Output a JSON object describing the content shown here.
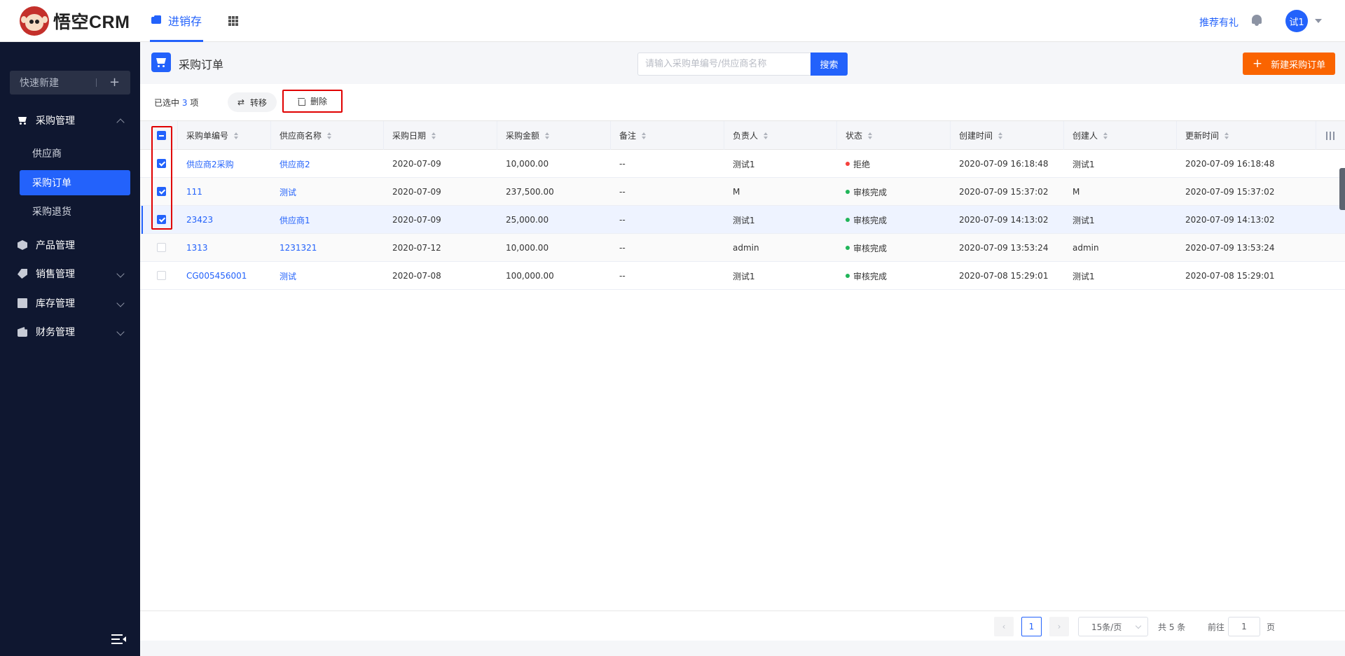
{
  "app": {
    "logo_text": "悟空CRM",
    "top_tab": "进销存",
    "recommend": "推荐有礼",
    "avatar_text": "试1"
  },
  "sidebar": {
    "quick_new": "快速新建",
    "groups": [
      {
        "label": "采购管理",
        "icon": "cart-icon",
        "expanded": true,
        "items": [
          {
            "label": "供应商"
          },
          {
            "label": "采购订单",
            "active": true
          },
          {
            "label": "采购退货"
          }
        ]
      },
      {
        "label": "产品管理",
        "icon": "box-icon"
      },
      {
        "label": "销售管理",
        "icon": "tag-icon"
      },
      {
        "label": "库存管理",
        "icon": "store-icon"
      },
      {
        "label": "财务管理",
        "icon": "wallet-icon"
      }
    ]
  },
  "header": {
    "title": "采购订单",
    "search_placeholder": "请输入采购单编号/供应商名称",
    "search_button": "搜索",
    "new_button": "新建采购订单"
  },
  "selection": {
    "prefix": "已选中",
    "count": "3",
    "suffix": "项",
    "transfer": "转移",
    "delete": "删除"
  },
  "table": {
    "columns": [
      "采购单编号",
      "供应商名称",
      "采购日期",
      "采购金额",
      "备注",
      "负责人",
      "状态",
      "创建时间",
      "创建人",
      "更新时间"
    ],
    "rows": [
      {
        "checked": true,
        "code": "供应商2采购",
        "supplier": "供应商2",
        "date": "2020-07-09",
        "amount": "10,000.00",
        "remark": "--",
        "owner": "测试1",
        "status": "拒绝",
        "status_color": "#f5403c",
        "created": "2020-07-09 16:18:48",
        "creator": "测试1",
        "updated": "2020-07-09 16:18:48"
      },
      {
        "checked": true,
        "code": "111",
        "supplier": "测试",
        "date": "2020-07-09",
        "amount": "237,500.00",
        "remark": "--",
        "owner": "M",
        "status": "审核完成",
        "status_color": "#20b559",
        "created": "2020-07-09 15:37:02",
        "creator": "M",
        "updated": "2020-07-09 15:37:02"
      },
      {
        "checked": true,
        "code": "23423",
        "supplier": "供应商1",
        "date": "2020-07-09",
        "amount": "25,000.00",
        "remark": "--",
        "owner": "测试1",
        "status": "审核完成",
        "status_color": "#20b559",
        "created": "2020-07-09 14:13:02",
        "creator": "测试1",
        "updated": "2020-07-09 14:13:02"
      },
      {
        "checked": false,
        "code": "1313",
        "supplier": "1231321",
        "date": "2020-07-12",
        "amount": "10,000.00",
        "remark": "--",
        "owner": "admin",
        "status": "审核完成",
        "status_color": "#20b559",
        "created": "2020-07-09 13:53:24",
        "creator": "admin",
        "updated": "2020-07-09 13:53:24"
      },
      {
        "checked": false,
        "code": "CG005456001",
        "supplier": "测试",
        "date": "2020-07-08",
        "amount": "100,000.00",
        "remark": "--",
        "owner": "测试1",
        "status": "审核完成",
        "status_color": "#20b559",
        "created": "2020-07-08 15:29:01",
        "creator": "测试1",
        "updated": "2020-07-08 15:29:01"
      }
    ]
  },
  "pagination": {
    "current": "1",
    "page_size": "15条/页",
    "total": "共 5 条",
    "goto_prefix": "前往",
    "goto_value": "1",
    "goto_suffix": "页"
  },
  "colors": {
    "primary": "#2362fb",
    "accent": "#fa6400",
    "sidebar_bg": "#0f1730",
    "highlight": "#e00000"
  }
}
